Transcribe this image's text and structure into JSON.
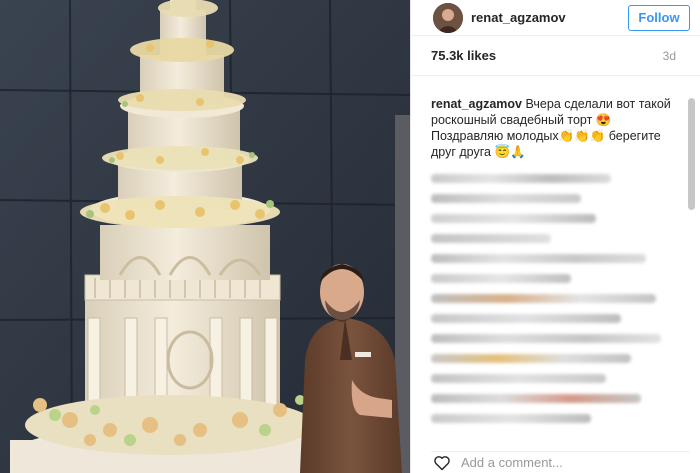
{
  "post": {
    "username": "renat_agzamov",
    "follow_label": "Follow",
    "likes": "75.3k likes",
    "time_ago": "3d",
    "caption_user": "renat_agzamov",
    "caption_text": "Вчера сделали вот такой роскошный свадебный торт 😍 Поздравляю молодых👏👏👏 берегите друг друга 😇🙏",
    "add_comment_placeholder": "Add a comment..."
  },
  "colors": {
    "follow_blue": "#3897f0",
    "wall": "#2d3440",
    "cake": "#ece3cf",
    "chef_jacket": "#6e4a36"
  }
}
